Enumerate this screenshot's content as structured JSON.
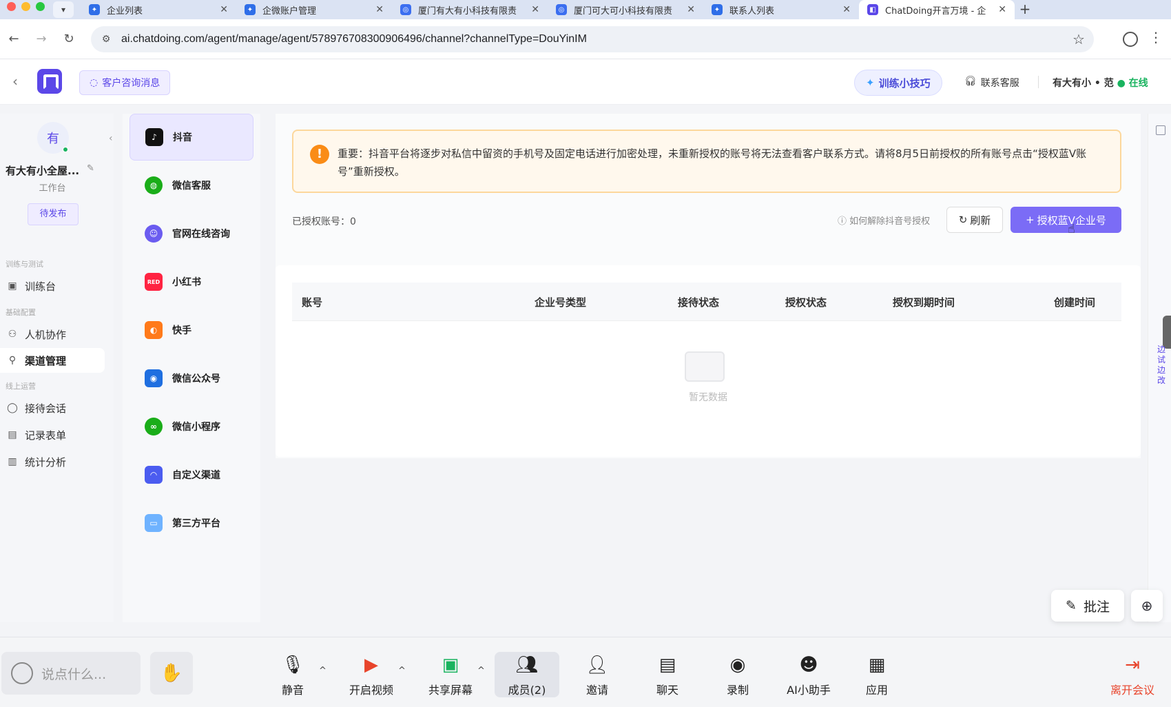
{
  "tabs": [
    {
      "title": "企业列表",
      "icon": "fans-logo-icon"
    },
    {
      "title": "企微账户管理",
      "icon": "fans-logo-icon"
    },
    {
      "title": "厦门有大有小科技有限责",
      "icon": "chatdoing-icon"
    },
    {
      "title": "厦门可大可小科技有限责",
      "icon": "chatdoing-icon"
    },
    {
      "title": "联系人列表",
      "icon": "fans-logo-icon"
    },
    {
      "title": "ChatDoing开言万境 - 企",
      "icon": "chatdoing-icon",
      "active": true
    }
  ],
  "address": {
    "url": "ai.chatdoing.com/agent/manage/agent/578976708300906496/channel?channelType=DouYinIM"
  },
  "header": {
    "consult_label": "客户咨询消息",
    "tips_label": "训练小技巧",
    "service_label": "联系客服",
    "user_label": "有大有小 • 范",
    "status_label": "在线"
  },
  "sidebar": {
    "avatar_char": "有",
    "workspace_name": "有大有小全屋...",
    "workspace_sub": "工作台",
    "pending_label": "待发布",
    "groups": [
      "训练与测试",
      "基础配置",
      "线上运营"
    ],
    "items": [
      {
        "label": "训练台",
        "icon": "monitor-icon"
      },
      {
        "label": "人机协作",
        "icon": "people-icon"
      },
      {
        "label": "渠道管理",
        "icon": "link-icon",
        "selected": true
      },
      {
        "label": "接待会话",
        "icon": "chat-icon"
      },
      {
        "label": "记录表单",
        "icon": "form-icon"
      },
      {
        "label": "统计分析",
        "icon": "bar-chart-icon"
      }
    ]
  },
  "channels": [
    {
      "label": "抖音",
      "color": "#111111",
      "selected": true
    },
    {
      "label": "微信客服",
      "color": "#1aad19"
    },
    {
      "label": "官网在线咨询",
      "color": "#6b5cf0"
    },
    {
      "label": "小红书",
      "color": "#ff2442"
    },
    {
      "label": "快手",
      "color": "#ff7a1a"
    },
    {
      "label": "微信公众号",
      "color": "#1f6fe0"
    },
    {
      "label": "微信小程序",
      "color": "#1aad19"
    },
    {
      "label": "自定义渠道",
      "color": "#4b5cf0"
    },
    {
      "label": "第三方平台",
      "color": "#6fb3ff"
    }
  ],
  "notice": {
    "text": "重要：抖音平台将逐步对私信中留资的手机号及固定电话进行加密处理，未重新授权的账号将无法查看客户联系方式。请将8月5日前授权的所有账号点击“授权蓝V账号”重新授权。"
  },
  "toolbar": {
    "auth_count_label": "已授权账号：0",
    "howto_label": "如何解除抖音号授权",
    "refresh_label": "刷新",
    "auth_button_label": "授权蓝V企业号"
  },
  "table": {
    "columns": [
      "账号",
      "企业号类型",
      "接待状态",
      "授权状态",
      "授权到期时间",
      "创建时间"
    ],
    "empty_text": "暂无数据"
  },
  "rail": {
    "text": "边试边改"
  },
  "floating": {
    "annotate_label": "批注"
  },
  "meeting": {
    "say_placeholder": "说点什么...",
    "tools": [
      "静音",
      "开启视频",
      "共享屏幕",
      "成员(2)",
      "邀请",
      "聊天",
      "录制",
      "AI小助手",
      "应用"
    ],
    "leave_label": "离开会议"
  }
}
